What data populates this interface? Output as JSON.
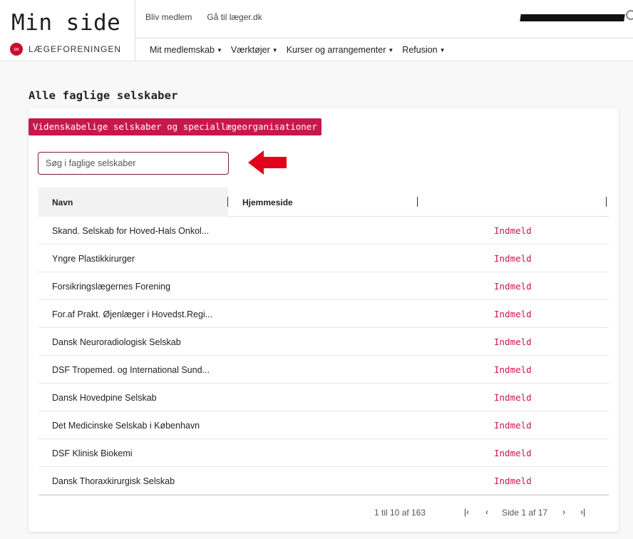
{
  "brand": {
    "title": "Min side",
    "logo_text": "LÆGEFORENINGEN",
    "logo_icon": "infinity-logo-icon"
  },
  "top_links": [
    "Bliv medlem",
    "Gå til læger.dk"
  ],
  "nav": [
    {
      "label": "Mit medlemskab"
    },
    {
      "label": "Værktøjer"
    },
    {
      "label": "Kurser og arrangementer"
    },
    {
      "label": "Refusion"
    }
  ],
  "page": {
    "heading": "Alle faglige selskaber",
    "tag": "Videnskabelige selskaber og speciallægeorganisationer"
  },
  "search": {
    "placeholder": "Søg i faglige selskaber",
    "value": ""
  },
  "table": {
    "columns": [
      "Navn",
      "Hjemmeside"
    ],
    "rows": [
      {
        "name": "Skand. Selskab for Hoved-Hals Onkol...",
        "action": "Indmeld"
      },
      {
        "name": "Yngre Plastikkirurger",
        "action": "Indmeld"
      },
      {
        "name": "Forsikringslægernes Forening",
        "action": "Indmeld"
      },
      {
        "name": "For.af Prakt. Øjenlæger i Hovedst.Regi...",
        "action": "Indmeld"
      },
      {
        "name": "Dansk Neuroradiologisk Selskab",
        "action": "Indmeld"
      },
      {
        "name": "DSF Tropemed. og International Sund...",
        "action": "Indmeld"
      },
      {
        "name": "Dansk Hovedpine Selskab",
        "action": "Indmeld"
      },
      {
        "name": "Det Medicinske Selskab i København",
        "action": "Indmeld"
      },
      {
        "name": "DSF Klinisk Biokemi",
        "action": "Indmeld"
      },
      {
        "name": "Dansk Thoraxkirurgisk Selskab",
        "action": "Indmeld"
      }
    ]
  },
  "pagination": {
    "range": "1 til 10 af 163",
    "first": "|‹",
    "prev": "‹",
    "page": "Side 1 af 17",
    "next": "›",
    "last": "›|"
  },
  "colors": {
    "accent": "#c8184a",
    "input_border": "#7a1a3c",
    "arrow": "#e2001a"
  }
}
